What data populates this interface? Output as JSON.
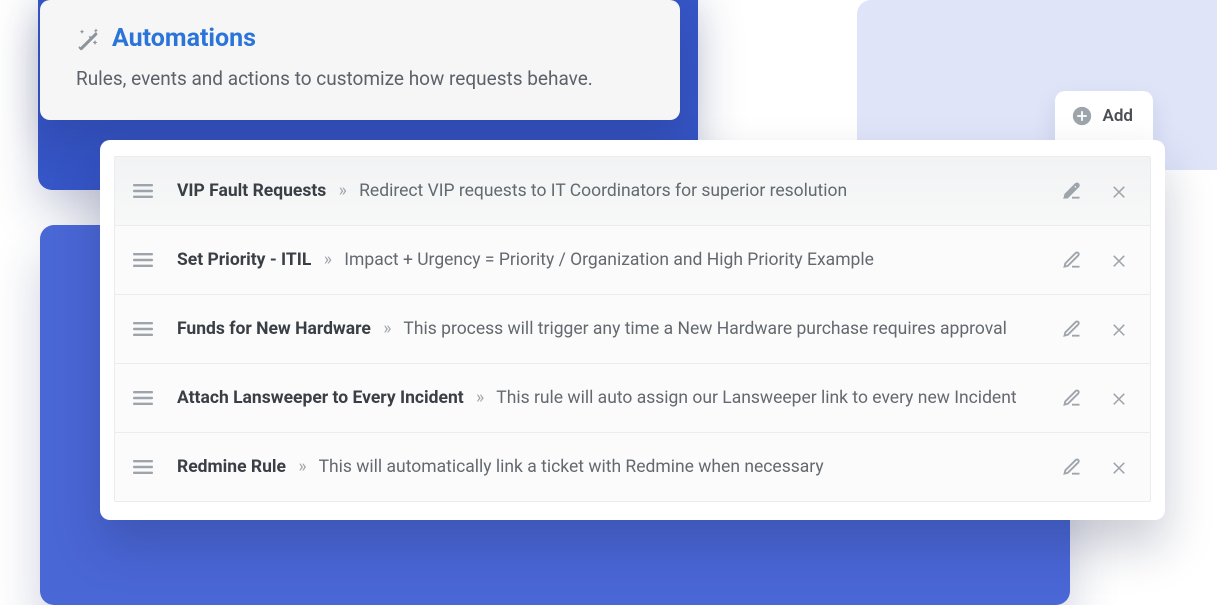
{
  "header": {
    "title": "Automations",
    "subtitle": "Rules, events and actions to customize how requests behave."
  },
  "add_button": {
    "label": "Add"
  },
  "separator": "»",
  "rules": [
    {
      "name": "VIP Fault Requests",
      "description": "Redirect VIP requests to IT Coordinators for superior resolution"
    },
    {
      "name": "Set Priority - ITIL",
      "description": "Impact + Urgency = Priority / Organization and High Priority Example"
    },
    {
      "name": "Funds for New Hardware",
      "description": "This process will trigger any time a New Hardware purchase requires approval"
    },
    {
      "name": "Attach Lansweeper to Every Incident",
      "description": "This rule will auto assign our Lansweeper link to every new Incident"
    },
    {
      "name": "Redmine Rule",
      "description": "This will automatically link a ticket with Redmine when necessary"
    }
  ]
}
